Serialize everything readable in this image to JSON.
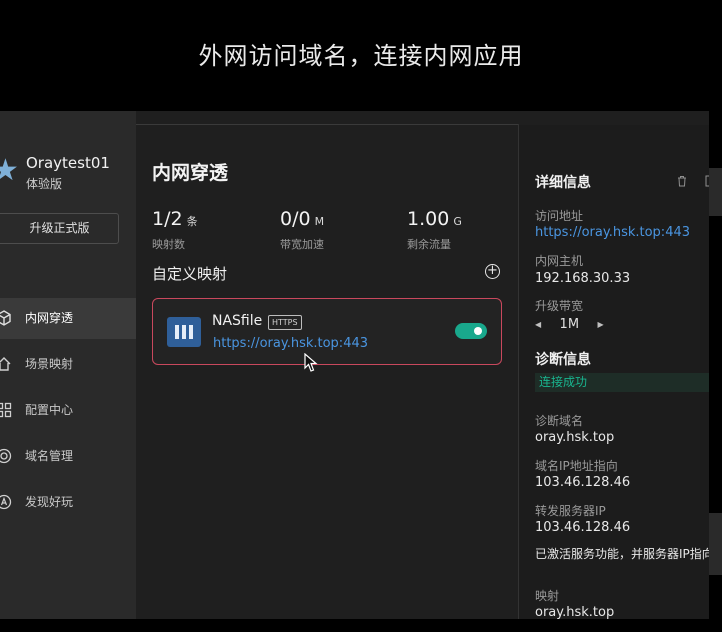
{
  "headline": "外网访问域名，连接内网应用",
  "sidebar": {
    "username": "Oraytest01",
    "plan": "体验版",
    "upgrade_label": "升级正式版",
    "items": [
      {
        "label": "内网穿透",
        "icon": "cube-icon",
        "active": true
      },
      {
        "label": "场景映射",
        "icon": "home-icon",
        "active": false
      },
      {
        "label": "配置中心",
        "icon": "grid-icon",
        "active": false
      },
      {
        "label": "域名管理",
        "icon": "target-icon",
        "active": false
      },
      {
        "label": "发现好玩",
        "icon": "compass-icon",
        "active": false
      }
    ]
  },
  "main": {
    "title": "内网穿透",
    "stats": [
      {
        "value": "1/2",
        "unit": "条",
        "label": "映射数"
      },
      {
        "value": "0/0",
        "unit": "M",
        "label": "带宽加速"
      },
      {
        "value": "1.00",
        "unit": "G",
        "label": "剩余流量"
      }
    ],
    "section_title": "自定义映射",
    "mapping": {
      "name": "NASfile",
      "protocol": "HTTPS",
      "url": "https://oray.hsk.top:443",
      "enabled": true
    }
  },
  "details": {
    "title": "详细信息",
    "access_label": "访问地址",
    "access_value": "https://oray.hsk.top:443",
    "host_label": "内网主机",
    "host_value": "192.168.30.33",
    "bandwidth_label": "升级带宽",
    "bandwidth_value": "1M",
    "diag_title": "诊断信息",
    "diag_status": "连接成功",
    "diag_domain_label": "诊断域名",
    "diag_domain_value": "oray.hsk.top",
    "ip_label": "域名IP地址指向",
    "ip_value": "103.46.128.46",
    "forward_label": "转发服务器IP",
    "forward_value": "103.46.128.46",
    "forward_note": "已激活服务功能，并服务器IP指向",
    "mapping_label": "映射",
    "mapping_value": "oray.hsk.top"
  },
  "colors": {
    "accent_link": "#4a95e0",
    "toggle_on": "#19a88c",
    "card_border": "#c9485d",
    "status_ok": "#19b58f"
  }
}
